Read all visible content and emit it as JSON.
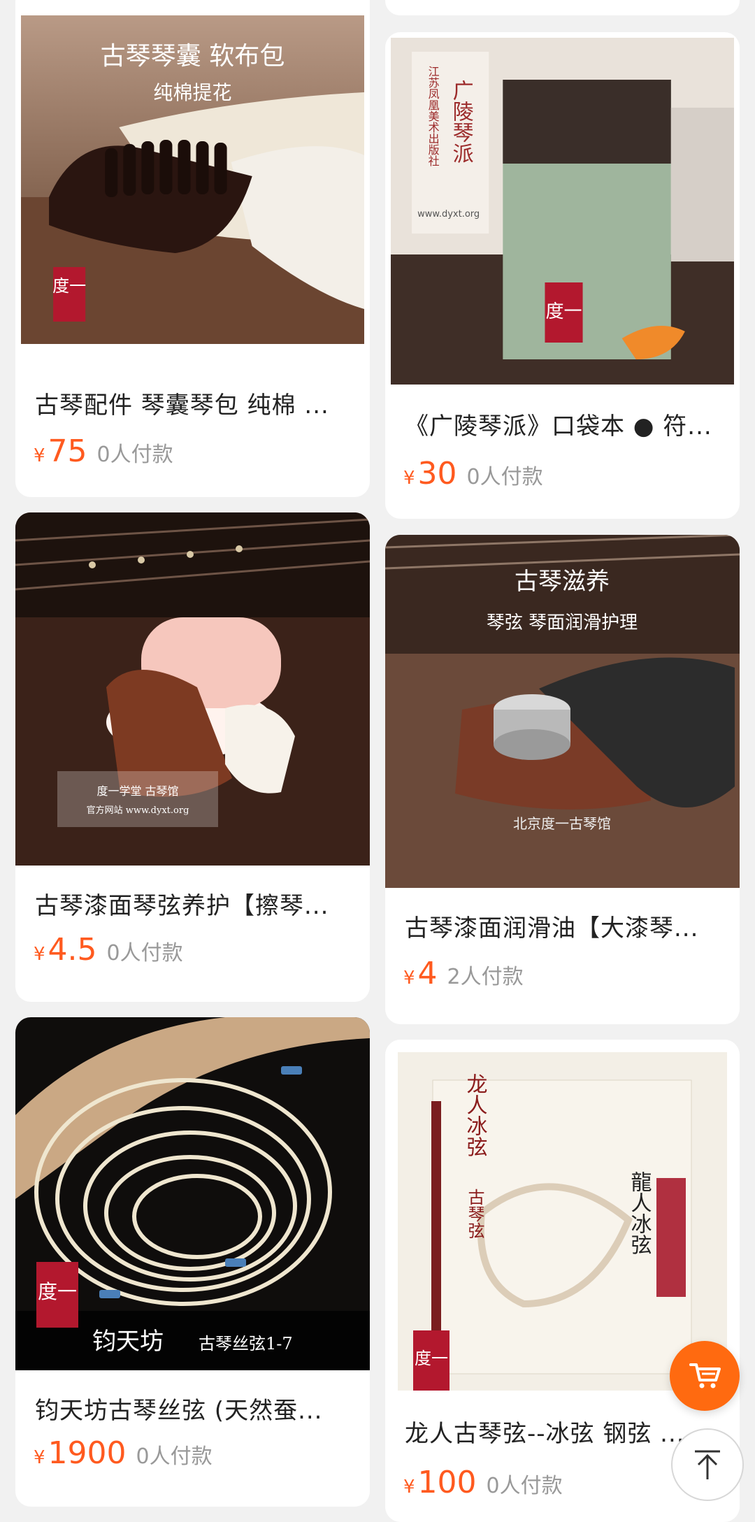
{
  "products": [
    {
      "title": "古琴配件 琴囊琴包 纯棉 ...",
      "currency": "¥",
      "price": "75",
      "paid": "0人付款",
      "image_text": {
        "line1": "古琴琴囊 软布包",
        "line2": "纯棉提花",
        "seal": "度一"
      }
    },
    {
      "title": "《广陵琴派》口袋本 ● 符...",
      "currency": "¥",
      "price": "30",
      "paid": "0人付款",
      "image_text": {
        "line1": "广陵琴派",
        "line2": "江苏凤凰美术出版社",
        "url": "www.dyxt.org",
        "seal": "度一"
      }
    },
    {
      "title": "古琴漆面琴弦养护【擦琴...",
      "currency": "¥",
      "price": "4.5",
      "paid": "0人付款",
      "image_text": {
        "line1": "度一学堂 古琴馆",
        "line2": "官方网站 www.dyxt.org"
      }
    },
    {
      "title": "古琴漆面润滑油【大漆琴...",
      "currency": "¥",
      "price": "4",
      "paid": "2人付款",
      "image_text": {
        "line1": "古琴滋养",
        "line2": "琴弦 琴面润滑护理",
        "line3": "北京度一古琴馆"
      }
    },
    {
      "title": "钧天坊古琴丝弦 (天然蚕...",
      "currency": "¥",
      "price": "1900",
      "paid": "0人付款",
      "image_text": {
        "line1": "钧天坊",
        "line2": "古琴丝弦1-7",
        "seal": "度一"
      }
    },
    {
      "title": "龙人古琴弦--冰弦 钢弦 ...",
      "currency": "¥",
      "price": "100",
      "paid": "0人付款",
      "image_text": {
        "line1": "龙人冰弦",
        "line2": "古琴弦",
        "line3": "龍人冰弦",
        "seal": "度一"
      }
    }
  ],
  "fab": {
    "cart_icon": "cart-icon",
    "top_icon": "back-to-top-icon"
  },
  "colors": {
    "accent": "#ff5a1f",
    "seal_red": "#b3182e"
  }
}
